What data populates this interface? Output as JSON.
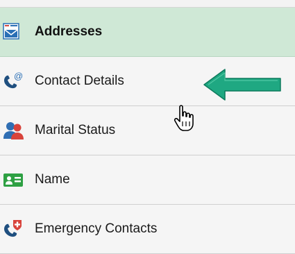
{
  "nav": {
    "items": [
      {
        "label": "Addresses",
        "icon": "envelope-icon",
        "selected": true
      },
      {
        "label": "Contact Details",
        "icon": "phone-at-icon",
        "selected": false
      },
      {
        "label": "Marital Status",
        "icon": "people-icon",
        "selected": false
      },
      {
        "label": "Name",
        "icon": "id-card-icon",
        "selected": false
      },
      {
        "label": "Emergency Contacts",
        "icon": "phone-cross-icon",
        "selected": false
      }
    ]
  },
  "colors": {
    "selected_background": "#cfe8d6",
    "item_background": "#f5f5f5",
    "arrow": "#1fa882",
    "divider": "#cfcfcf"
  }
}
